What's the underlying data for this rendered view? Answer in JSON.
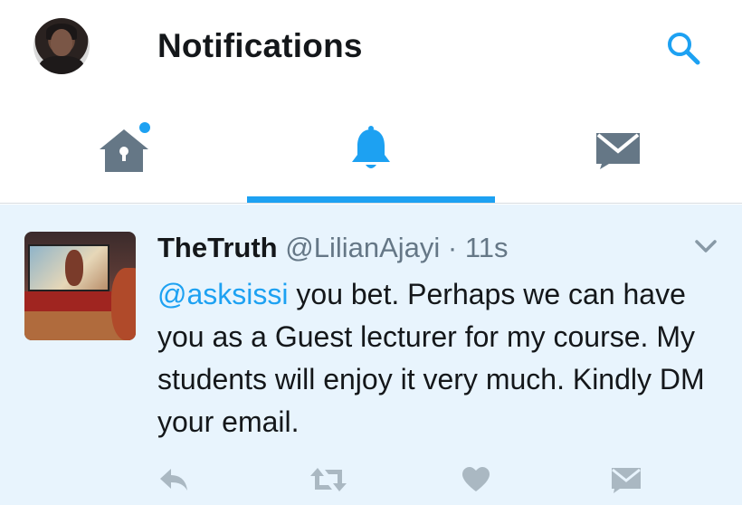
{
  "header": {
    "title": "Notifications",
    "icons": {
      "avatar": "profile-avatar",
      "search": "search-icon"
    }
  },
  "tabs": [
    {
      "name": "home",
      "icon": "home-icon",
      "badge": "new-dot",
      "active": false
    },
    {
      "name": "notifications",
      "icon": "bell-icon",
      "active": true
    },
    {
      "name": "messages",
      "icon": "envelope-icon",
      "active": false
    }
  ],
  "tweet": {
    "name": "TheTruth",
    "handle": "@LilianAjayi",
    "separator": "·",
    "time": "11s",
    "mention": "@asksissi",
    "text": " you bet. Perhaps we can have you as a Guest lecturer for my course. My students will enjoy it very much. Kindly DM your email.",
    "actions": [
      "reply-icon",
      "retweet-icon",
      "like-icon",
      "direct-message-icon"
    ]
  },
  "colors": {
    "accent": "#1da1f2",
    "icon_gray": "#657786",
    "highlight_bg": "#e8f4fd",
    "text": "#14171a"
  }
}
